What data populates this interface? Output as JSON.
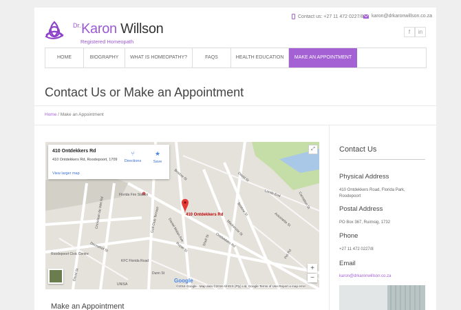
{
  "brand": {
    "dr": "Dr.",
    "first_name": "Karon",
    "last_name": "Willson",
    "tagline": "Registered Homeopath"
  },
  "header": {
    "phone": "Contact us: +27 11 472 0227/8",
    "email": "karon@drkaronwillson.co.za",
    "social": [
      {
        "icon": "facebook-icon",
        "glyph": "f"
      },
      {
        "icon": "linkedin-icon",
        "glyph": "in"
      }
    ]
  },
  "nav": {
    "items": [
      {
        "label": "HOME"
      },
      {
        "label": "BIOGRAPHY"
      },
      {
        "label": "WHAT IS HOMEOPATHY?"
      },
      {
        "label": "FAQS"
      },
      {
        "label": "HEALTH EDUCATION"
      },
      {
        "label": "MAKE AN APPOINTMENT",
        "active": true
      }
    ],
    "active_color": "#a361d4"
  },
  "page": {
    "title": "Contact Us or Make an Appointment",
    "breadcrumb_home": "Home",
    "breadcrumb_sep": " / ",
    "breadcrumb_current": "Make an Appointment",
    "section_title": "Make an Appointment"
  },
  "map": {
    "card_title": "410 Ontdekkers Rd",
    "card_address": "410 Ontdekkers Rd, Roodepoort, 1709",
    "directions": "Directions",
    "save": "Save",
    "larger_map": "View larger map",
    "pin_label": "410 Ontdekkers Rd",
    "google": "Google",
    "footer": "©2016 Google - Map data ©2016 AfriGIS (Pty) Ltd, Google    Terms of Use    Report a map error",
    "zoom_in": "+",
    "zoom_out": "−",
    "streets": {
      "bristow1": "Bristow St",
      "david": "David St",
      "lands_end": "Lands End",
      "carnation": "Carnation St",
      "florida_fire": "Florida Fire Station",
      "bristow2": "Bristow St",
      "mackenzie": "Mackenzie St",
      "antoinette": "Antoinette St",
      "ontdekkers": "Ontdekkers Rd",
      "golf_club": "Golf Club Terrace",
      "daniel_malan": "Daniel Malan Ave",
      "roper": "Roper St",
      "shell": "Shell St",
      "dennehof": "Dennehof St",
      "christiaan": "Christiaan de Wet Rd",
      "roodepoort_civic": "Roodepoort Civic Centre",
      "kfc": "KFC Florida Road",
      "unisa": "UNISA",
      "dunn": "Dunn St",
      "david2": "David St",
      "pet": "Pet Rd"
    }
  },
  "sidebar": {
    "title": "Contact Us",
    "physical_heading": "Physical Address",
    "physical_address": "410 Ontdekkers Road, Florida Park, Roodepoort",
    "postal_heading": "Postal Address",
    "postal_address": "PO Box 367, Ruimsig, 1732",
    "phone_heading": "Phone",
    "phone": "+27 11 472 0227/8",
    "email_heading": "Email",
    "email": "karon@drkaronwillson.co.za"
  }
}
